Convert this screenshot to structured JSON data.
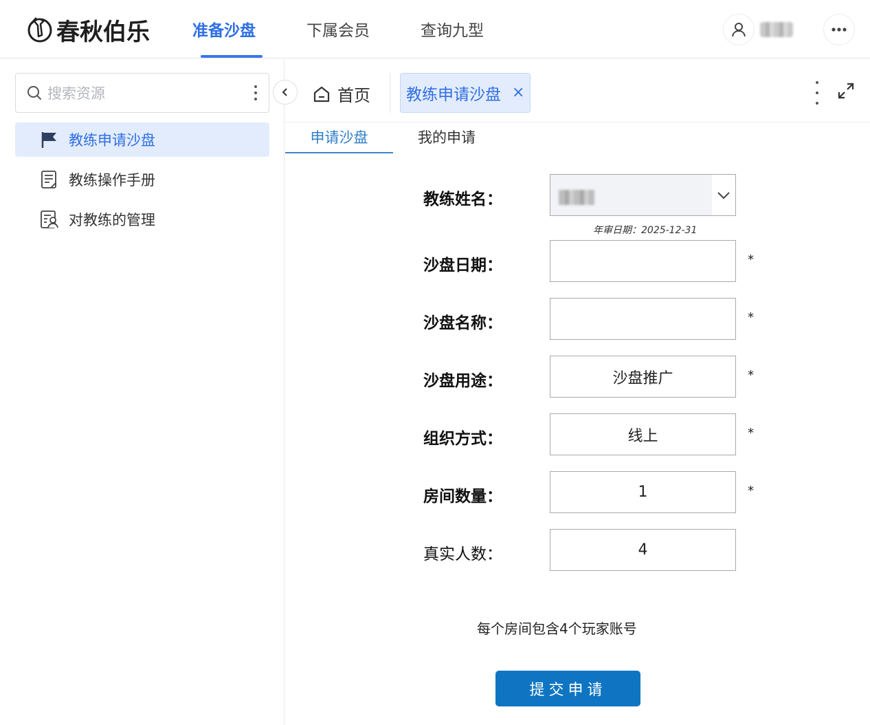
{
  "brand": {
    "name": "春秋伯乐"
  },
  "top_nav": {
    "items": [
      {
        "label": "准备沙盘",
        "active": true
      },
      {
        "label": "下属会员",
        "active": false
      },
      {
        "label": "查询九型",
        "active": false
      }
    ]
  },
  "user": {
    "avatar_icon": "user-icon",
    "more_icon": "more-horizontal-icon"
  },
  "sidebar": {
    "search_placeholder": "搜索资源",
    "items": [
      {
        "label": "教练申请沙盘",
        "icon": "flag-icon",
        "active": true
      },
      {
        "label": "教练操作手册",
        "icon": "document-icon",
        "active": false
      },
      {
        "label": "对教练的管理",
        "icon": "manage-icon",
        "active": false
      }
    ]
  },
  "tabs": {
    "home_label": "首页",
    "open_tab": {
      "label": "教练申请沙盘",
      "close": "×"
    }
  },
  "sub_tabs": [
    {
      "label": "申请沙盘",
      "active": true
    },
    {
      "label": "我的申请",
      "active": false
    }
  ],
  "form": {
    "coach_name_label": "教练姓名：",
    "review_date_note": "年审日期：2025-12-31",
    "fields": [
      {
        "label": "沙盘日期：",
        "value": "",
        "required": "*"
      },
      {
        "label": "沙盘名称：",
        "value": "",
        "required": "*"
      },
      {
        "label": "沙盘用途：",
        "value": "沙盘推广",
        "required": "*"
      },
      {
        "label": "组织方式：",
        "value": "线上",
        "required": "*"
      },
      {
        "label": "房间数量：",
        "value": "1",
        "required": "*"
      },
      {
        "label": "真实人数：",
        "value": "4",
        "required": ""
      }
    ],
    "hint": "每个房间包含4个玩家账号",
    "submit_label": "提交申请"
  },
  "colors": {
    "accent": "#2f6fe4",
    "submit": "#0f75c2",
    "active_bg": "#e3ecfc"
  }
}
